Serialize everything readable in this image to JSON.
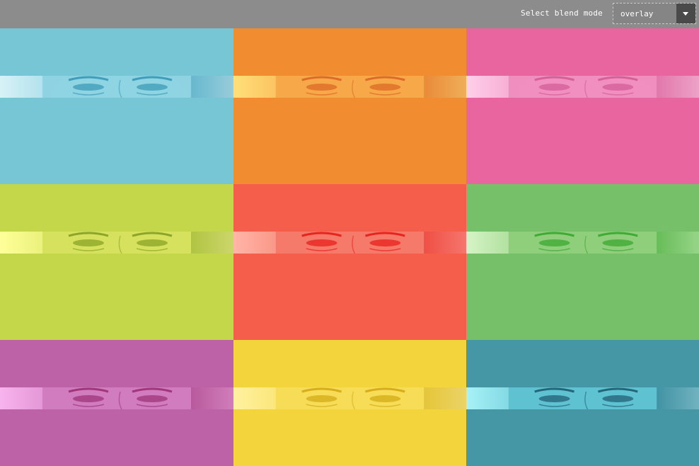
{
  "toolbar": {
    "label": "Select blend mode",
    "select_value": "overlay",
    "caret_icon": "chevron-down-icon"
  },
  "tiles": [
    {
      "name": "blend-tile-cyan",
      "color": "#76c6d6",
      "strip": {
        "base": "#8fd3e2",
        "light": "#d8f2f7",
        "dark": "#1f86a8"
      }
    },
    {
      "name": "blend-tile-orange",
      "color": "#f28c30",
      "strip": {
        "base": "#f7a94a",
        "light": "#ffe07a",
        "dark": "#d2521a"
      }
    },
    {
      "name": "blend-tile-pink",
      "color": "#e8659f",
      "strip": {
        "base": "#f08fbf",
        "light": "#ffd0ea",
        "dark": "#c84d86"
      }
    },
    {
      "name": "blend-tile-lime",
      "color": "#c4d64a",
      "strip": {
        "base": "#d6e25e",
        "light": "#ffff9a",
        "dark": "#6e8d12"
      }
    },
    {
      "name": "blend-tile-red",
      "color": "#f55e4a",
      "strip": {
        "base": "#f57a6a",
        "light": "#ffb6a8",
        "dark": "#e30000"
      }
    },
    {
      "name": "blend-tile-green",
      "color": "#76c06a",
      "strip": {
        "base": "#8fcf7c",
        "light": "#d6f4c6",
        "dark": "#1f9a16"
      }
    },
    {
      "name": "blend-tile-magenta",
      "color": "#bd62a6",
      "strip": {
        "base": "#d27cc0",
        "light": "#f8b4ee",
        "dark": "#8a1a5c"
      }
    },
    {
      "name": "blend-tile-yellow",
      "color": "#f4d43c",
      "strip": {
        "base": "#f7dc58",
        "light": "#fff2a0",
        "dark": "#c79a00"
      }
    },
    {
      "name": "blend-tile-teal",
      "color": "#4597a5",
      "strip": {
        "base": "#5fc2d0",
        "light": "#a8f2f8",
        "dark": "#0b3d56"
      }
    }
  ]
}
